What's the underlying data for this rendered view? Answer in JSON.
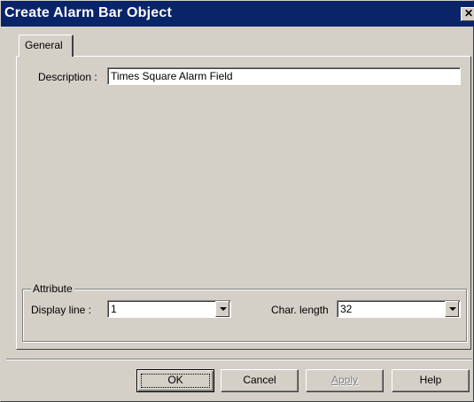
{
  "window": {
    "title": "Create Alarm Bar Object",
    "close_glyph": "✕"
  },
  "tabs": [
    {
      "label": "General",
      "selected": true
    }
  ],
  "general": {
    "description_label": "Description :",
    "description_value": "Times Square Alarm Field"
  },
  "attribute": {
    "group_label": "Attribute",
    "display_line_label": "Display line :",
    "display_line_value": "1",
    "char_length_label": "Char. length",
    "char_length_value": "32"
  },
  "buttons": {
    "ok": "OK",
    "cancel": "Cancel",
    "apply": "Apply",
    "help": "Help"
  },
  "colors": {
    "titlebar": "#0a246a",
    "face": "#d4d0c8"
  },
  "icons": {
    "close": "close-icon",
    "dropdown": "chevron-down-icon"
  }
}
